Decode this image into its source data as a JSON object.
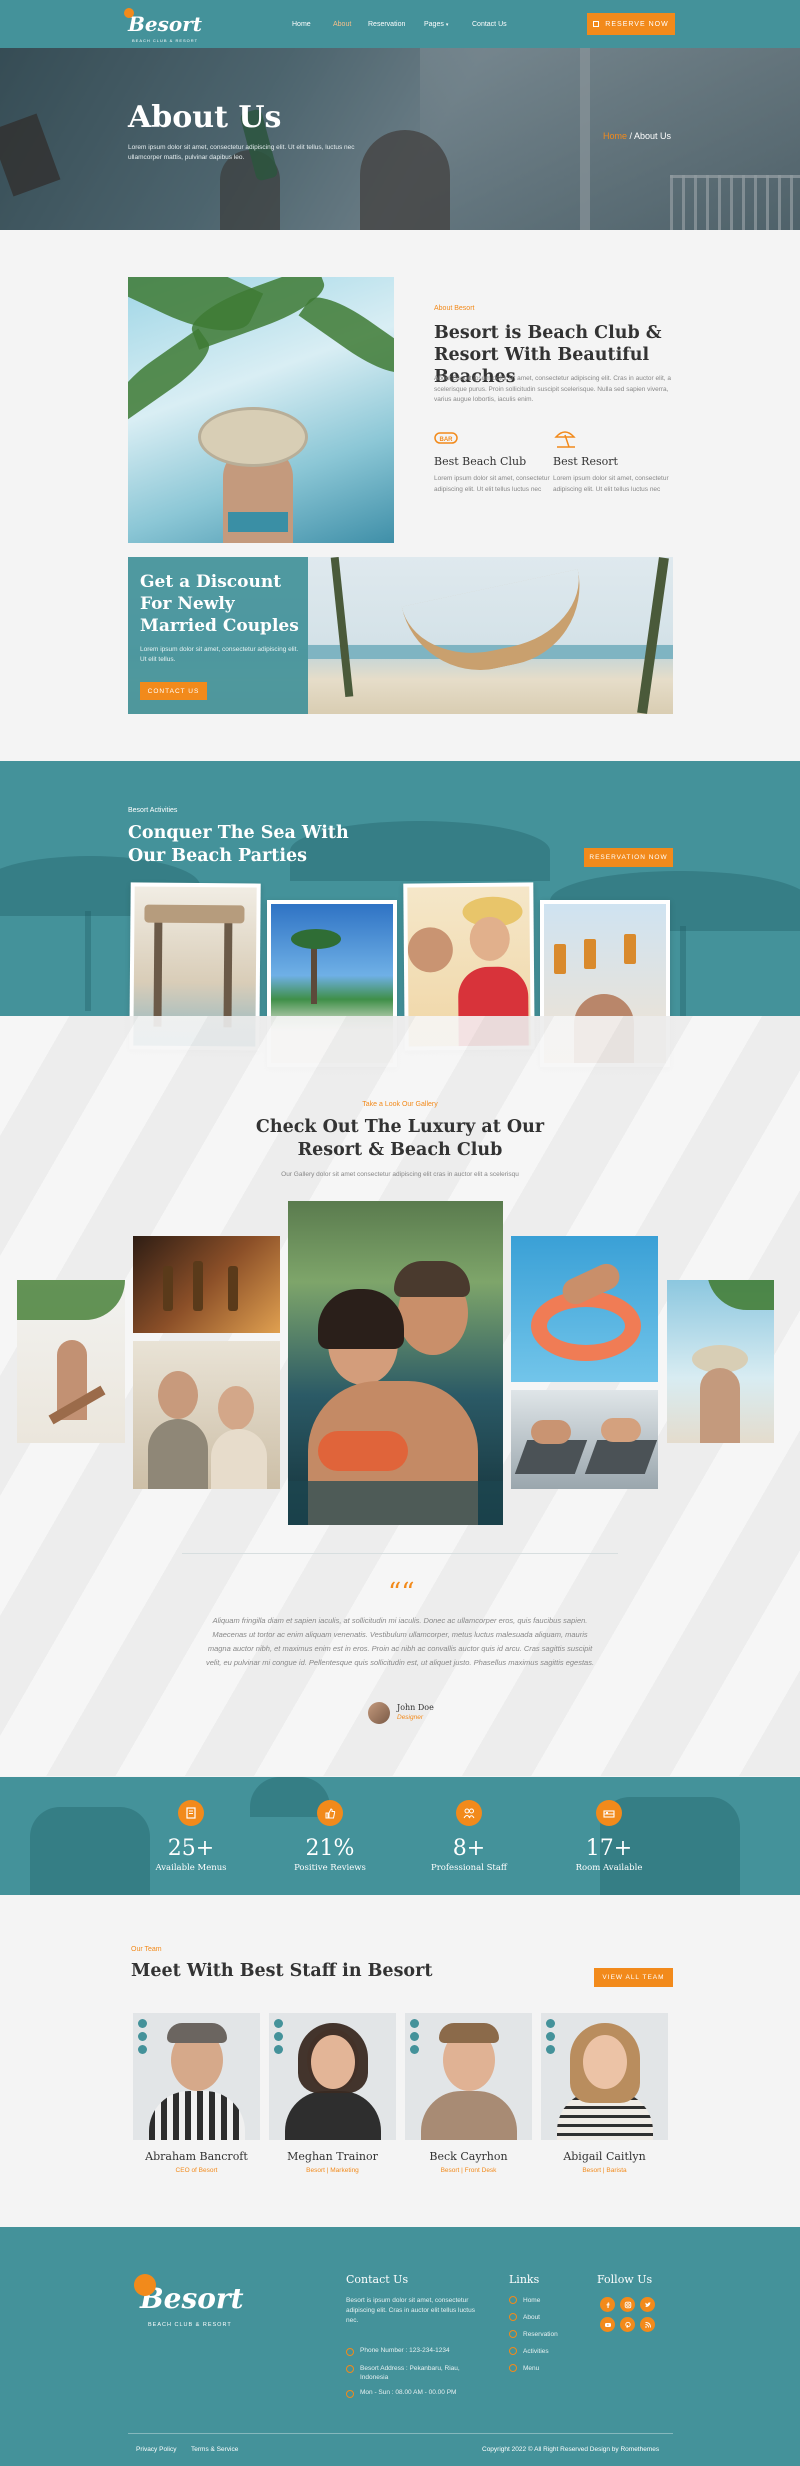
{
  "brand": {
    "name": "Besort",
    "tagline": "BEACH CLUB & RESORT"
  },
  "nav": {
    "items": [
      "Home",
      "About",
      "Reservation",
      "Pages",
      "Contact Us"
    ],
    "active": "About",
    "reserve_label": "RESERVE NOW"
  },
  "hero": {
    "title": "About Us",
    "text": "Lorem ipsum dolor sit amet, consectetur adipiscing elit. Ut elit tellus, luctus nec ullamcorper mattis, pulvinar dapibus leo.",
    "crumb_home": "Home",
    "crumb_sep": " / ",
    "crumb_current": "About Us"
  },
  "about": {
    "tag": "About Besort",
    "title": "Besort is Beach Club & Resort With Beautiful Beaches",
    "text": "About Besort ipsum dolor sit amet, consectetur adipiscing elit. Cras in auctor elit, a scelerisque purus. Proin sollicitudin suscipit scelerisque. Nulla sed sapien viverra, varius augue lobortis, iaculis enim.",
    "features": [
      {
        "icon": "bar-sign-icon",
        "title": "Best Beach Club",
        "text": "Lorem ipsum dolor sit amet, consectetur adipiscing elit. Ut elit tellus luctus nec"
      },
      {
        "icon": "beach-umbrella-icon",
        "title": "Best Resort",
        "text": "Lorem ipsum dolor sit amet, consectetur adipiscing elit. Ut elit tellus luctus nec"
      }
    ]
  },
  "discount": {
    "title": "Get a Discount For Newly Married Couples",
    "text": "Lorem ipsum dolor sit amet, consectetur adipiscing elit. Ut elit tellus.",
    "button": "CONTACT US"
  },
  "activities": {
    "tag": "Besort Activities",
    "title": "Conquer The Sea With Our Beach Parties",
    "button": "RESERVATION NOW"
  },
  "gallery": {
    "tag": "Take a Look Our Gallery",
    "title": "Check Out The Luxury at Our Resort & Beach Club",
    "subtitle": "Our Gallery dolor sit amet consectetur adipiscing elit cras in auctor elit a scelerisqu"
  },
  "testimonial": {
    "quote": "Aliquam fringilla diam et sapien iaculis, at sollicitudin mi iaculis. Donec ac ullamcorper eros, quis faucibus sapien. Maecenas ut tortor ac enim aliquam venenatis. Vestibulum ullamcorper, metus luctus malesuada aliquam, mauris magna auctor nibh, et maximus enim est in eros. Proin ac nibh ac convallis auctor quis id arcu. Cras sagittis suscipit velit, eu pulvinar mi congue id. Pellentesque quis sollicitudin est, ut aliquet justo. Phasellus maximus sagittis egestas.",
    "name": "John Doe",
    "role": "Designer"
  },
  "stats": [
    {
      "icon": "menu-book-icon",
      "value": "25+",
      "label": "Available Menus"
    },
    {
      "icon": "thumbs-up-icon",
      "value": "21%",
      "label": "Positive Reviews"
    },
    {
      "icon": "staff-icon",
      "value": "8+",
      "label": "Professional Staff"
    },
    {
      "icon": "room-icon",
      "value": "17+",
      "label": "Room Available"
    }
  ],
  "team": {
    "tag": "Our Team",
    "title": "Meet With Best Staff in Besort",
    "button": "VIEW ALL TEAM",
    "members": [
      {
        "name": "Abraham Bancroft",
        "role": "CEO of Besort"
      },
      {
        "name": "Meghan Trainor",
        "role": "Besort | Marketing"
      },
      {
        "name": "Beck Cayrhon",
        "role": "Besort | Front Desk"
      },
      {
        "name": "Abigail Caitlyn",
        "role": "Besort | Barista"
      }
    ]
  },
  "footer": {
    "contact_title": "Contact Us",
    "contact_text": "Besort is ipsum dolor sit amet, consectetur adipiscing elit. Cras in auctor elit tellus luctus nec.",
    "phone": "Phone Number : 123-234-1234",
    "address": "Besort Address : Pekanbaru, Riau, Indonesia",
    "hours": "Mon - Sun : 08.00 AM - 00.00 PM",
    "links_title": "Links",
    "links": [
      "Home",
      "About",
      "Reservation",
      "Activities",
      "Menu"
    ],
    "follow_title": "Follow Us",
    "privacy": "Privacy Policy",
    "terms": "Terms & Service",
    "copyright": "Copyright 2022 © All Right Reserved Design by Romethemes"
  },
  "colors": {
    "teal": "#44929a",
    "orange": "#f28a1b"
  }
}
